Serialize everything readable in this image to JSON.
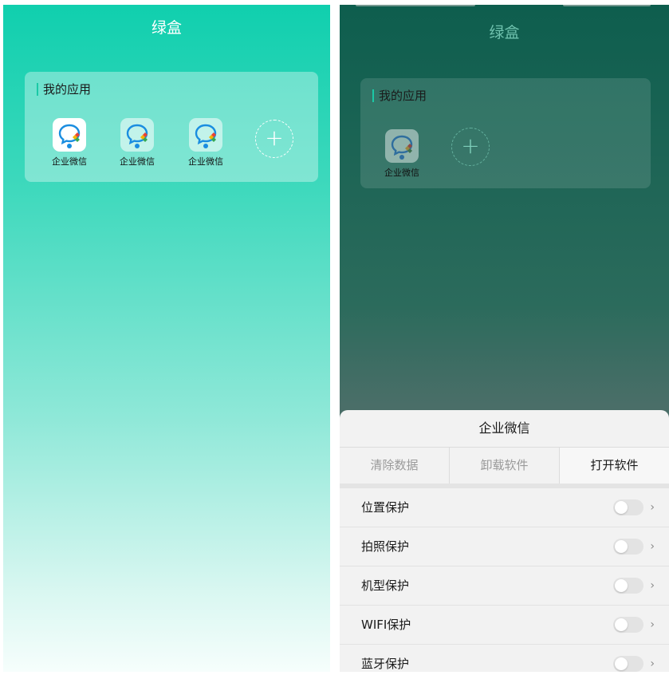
{
  "left": {
    "title": "绿盒",
    "section_title": "我的应用",
    "apps": [
      {
        "label": "企业微信",
        "icon": "wecom-icon"
      },
      {
        "label": "企业微信",
        "icon": "wecom-icon"
      },
      {
        "label": "企业微信",
        "icon": "wecom-icon"
      }
    ],
    "add_icon": "plus-circle-icon"
  },
  "right": {
    "title": "绿盒",
    "section_title": "我的应用",
    "apps": [
      {
        "label": "企业微信",
        "icon": "wecom-icon"
      }
    ],
    "add_icon": "plus-circle-icon",
    "sheet": {
      "app_name": "企业微信",
      "actions": {
        "clear_data": "清除数据",
        "uninstall": "卸载软件",
        "open": "打开软件"
      },
      "settings": [
        {
          "label": "位置保护",
          "enabled": false
        },
        {
          "label": "拍照保护",
          "enabled": false
        },
        {
          "label": "机型保护",
          "enabled": false
        },
        {
          "label": "WIFI保护",
          "enabled": false
        },
        {
          "label": "蓝牙保护",
          "enabled": false
        }
      ]
    }
  },
  "colors": {
    "accent": "#1bc9a6",
    "header_gradient_top": "#10cfae",
    "overlay": "#0e5e4e"
  }
}
